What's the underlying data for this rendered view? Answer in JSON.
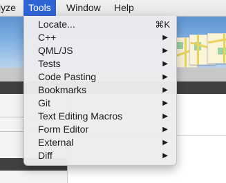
{
  "menubar": {
    "items": [
      {
        "label": "lyze"
      },
      {
        "label": "Tools"
      },
      {
        "label": "Window"
      },
      {
        "label": "Help"
      }
    ]
  },
  "tools_menu": {
    "items": [
      {
        "label": "Locate...",
        "shortcut": "⌘K",
        "submenu": false
      },
      {
        "label": "C++",
        "submenu": true
      },
      {
        "label": "QML/JS",
        "submenu": true
      },
      {
        "label": "Tests",
        "submenu": true
      },
      {
        "label": "Code Pasting",
        "submenu": true
      },
      {
        "label": "Bookmarks",
        "submenu": true
      },
      {
        "label": "Git",
        "submenu": true
      },
      {
        "label": "Text Editing Macros",
        "submenu": true
      },
      {
        "label": "Form Editor",
        "submenu": true
      },
      {
        "label": "External",
        "submenu": true
      },
      {
        "label": "Diff",
        "submenu": true
      }
    ],
    "submenu_arrow": "▶"
  },
  "colors": {
    "menu_highlight": "#2e63d6",
    "toolbar_top": "#5e93d1",
    "dark_bar": "#414141"
  }
}
